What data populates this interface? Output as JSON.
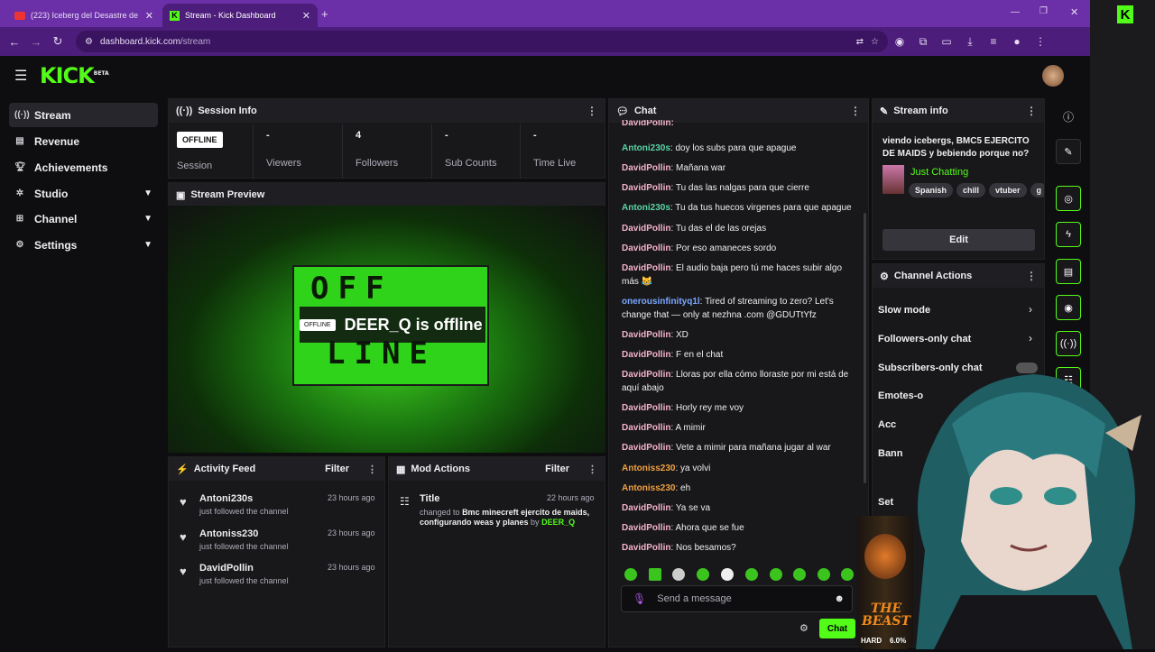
{
  "browser": {
    "tabs": [
      {
        "title": "(223) Iceberg del Desastre de C",
        "active": false
      },
      {
        "title": "Stream - Kick Dashboard",
        "active": true
      }
    ],
    "url_host": "dashboard.kick.com",
    "url_path": "/stream"
  },
  "header": {
    "logo": "KICK",
    "beta": "BETA"
  },
  "sidebar": {
    "items": [
      {
        "label": "Stream",
        "icon": "stream-icon",
        "active": true,
        "expandable": false
      },
      {
        "label": "Revenue",
        "icon": "revenue-icon",
        "active": false,
        "expandable": false
      },
      {
        "label": "Achievements",
        "icon": "trophy-icon",
        "active": false,
        "expandable": false
      },
      {
        "label": "Studio",
        "icon": "studio-icon",
        "active": false,
        "expandable": true
      },
      {
        "label": "Channel",
        "icon": "channel-icon",
        "active": false,
        "expandable": true
      },
      {
        "label": "Settings",
        "icon": "gear-icon",
        "active": false,
        "expandable": true
      }
    ]
  },
  "session": {
    "title": "Session Info",
    "status": "OFFLINE",
    "status_label": "Session",
    "stats": [
      {
        "value": "-",
        "label": "Viewers"
      },
      {
        "value": "4",
        "label": "Followers"
      },
      {
        "value": "-",
        "label": "Sub Counts"
      },
      {
        "value": "-",
        "label": "Time Live"
      }
    ]
  },
  "preview": {
    "title": "Stream Preview",
    "badge": "OFFLINE",
    "message": "DEER_Q is offline",
    "screen_line1": "OFF",
    "screen_line2": "LINE"
  },
  "activity": {
    "title": "Activity Feed",
    "filter": "Filter",
    "items": [
      {
        "name": "Antoni230s",
        "action": "just followed the channel",
        "time": "23 hours ago"
      },
      {
        "name": "Antoniss230",
        "action": "just followed the channel",
        "time": "23 hours ago"
      },
      {
        "name": "DavidPollin",
        "action": "just followed the channel",
        "time": "23 hours ago"
      }
    ]
  },
  "mod": {
    "title": "Mod Actions",
    "filter": "Filter",
    "item_title": "Title",
    "item_time": "22 hours ago",
    "item_prefix": "changed to",
    "item_value": "Bmc minecreft ejercito de maids, configurando weas y planes",
    "item_by": "by",
    "item_user": "DEER_Q"
  },
  "chat": {
    "title": "Chat",
    "partial_top": "DavidPollin:",
    "messages": [
      {
        "user": "Antoni230s",
        "color": "u2",
        "text": "doy los subs para que apague"
      },
      {
        "user": "DavidPollin",
        "color": "u1",
        "text": "Mañana war"
      },
      {
        "user": "DavidPollin",
        "color": "u1",
        "text": "Tu das las nalgas para que cierre"
      },
      {
        "user": "Antoni230s",
        "color": "u2",
        "text": "Tu da tus huecos virgenes para que apague"
      },
      {
        "user": "DavidPollin",
        "color": "u1",
        "text": "Tu das el de las orejas"
      },
      {
        "user": "DavidPollin",
        "color": "u1",
        "text": "Por eso amaneces sordo"
      },
      {
        "user": "DavidPollin",
        "color": "u1",
        "text": "El audio baja pero tú me haces subir algo más 😹"
      },
      {
        "user": "onerousinfinityq1l",
        "color": "u3",
        "text": "Tired of streaming to zero? Let's change that — only at nezhna .com @GDUTtYfz"
      },
      {
        "user": "DavidPollin",
        "color": "u1",
        "text": "XD"
      },
      {
        "user": "DavidPollin",
        "color": "u1",
        "text": "F en el chat"
      },
      {
        "user": "DavidPollin",
        "color": "u1",
        "text": "Lloras por ella cómo lloraste por mi está de aquí abajo"
      },
      {
        "user": "DavidPollin",
        "color": "u1",
        "text": "Horly rey me voy"
      },
      {
        "user": "DavidPollin",
        "color": "u1",
        "text": "A mimir"
      },
      {
        "user": "DavidPollin",
        "color": "u1",
        "text": "Vete a mimir para mañana jugar al war"
      },
      {
        "user": "Antoniss230",
        "color": "u4",
        "text": "ya volvi"
      },
      {
        "user": "Antoniss230",
        "color": "u4",
        "text": "eh"
      },
      {
        "user": "DavidPollin",
        "color": "u1",
        "text": "Ya se va"
      },
      {
        "user": "DavidPollin",
        "color": "u1",
        "text": "Ahora que se fue"
      },
      {
        "user": "DavidPollin",
        "color": "u1",
        "text": "Nos besamos?"
      }
    ],
    "placeholder": "Send a message",
    "send": "Chat"
  },
  "stream_info": {
    "title": "Stream info",
    "stream_title": "viendo icebergs, BMC5 EJERCITO DE MAIDS y bebiendo porque no?",
    "category": "Just Chatting",
    "tags": [
      "Spanish",
      "chill",
      "vtuber",
      "g"
    ],
    "edit": "Edit"
  },
  "channel_actions": {
    "title": "Channel Actions",
    "items": [
      "Slow mode",
      "Followers-only chat",
      "Subscribers-only chat",
      "Emotes-o",
      "Acc",
      "Bann",
      "Set"
    ]
  },
  "overlay": {
    "can_brand": "THE BEAST",
    "can_sub": "HARD",
    "can_abv": "6.0%"
  },
  "colors": {
    "accent": "#53fc18",
    "browser": "#6b2fa8"
  }
}
